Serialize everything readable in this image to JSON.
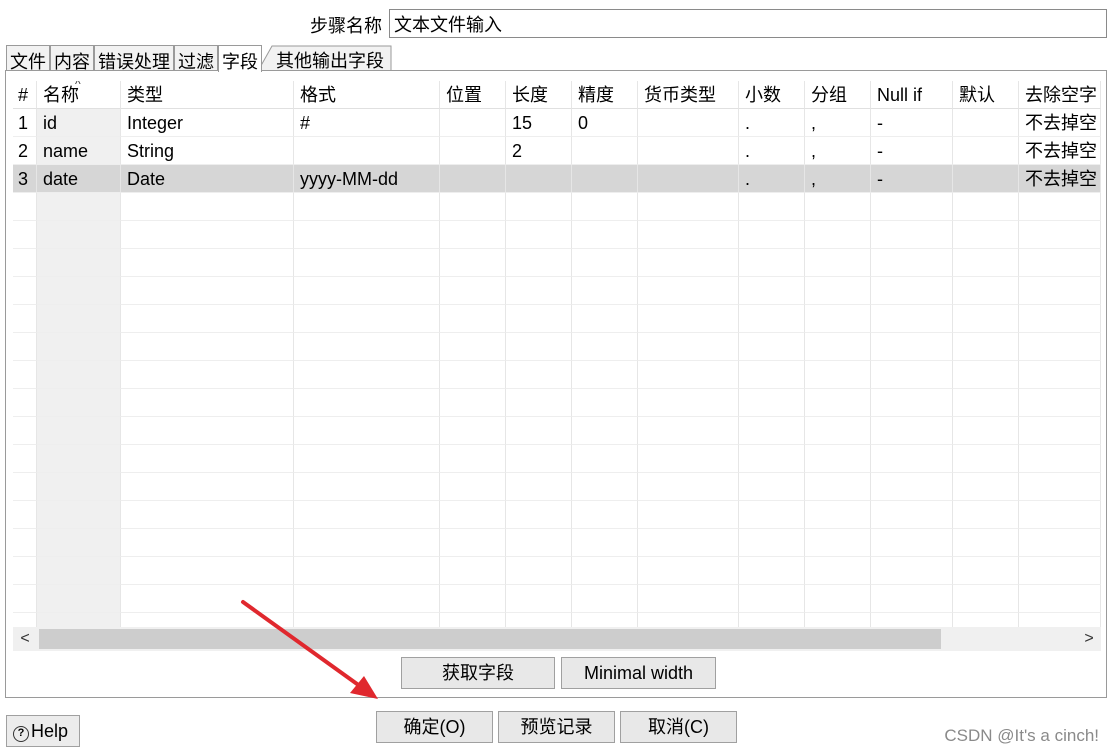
{
  "step": {
    "label": "步骤名称",
    "value": "文本文件输入"
  },
  "tabs": [
    {
      "label": "文件",
      "active": false
    },
    {
      "label": "内容",
      "active": false
    },
    {
      "label": "错误处理",
      "active": false
    },
    {
      "label": "过滤",
      "active": false
    },
    {
      "label": "字段",
      "active": true
    },
    {
      "label": "其他输出字段",
      "active": false
    }
  ],
  "table": {
    "columns": [
      "#",
      "名称",
      "类型",
      "格式",
      "位置",
      "长度",
      "精度",
      "货币类型",
      "小数",
      "分组",
      "Null if",
      "默认",
      "去除空字"
    ],
    "rows": [
      [
        "1",
        "id",
        "Integer",
        "#",
        "",
        "15",
        "0",
        "",
        ".",
        ",",
        "-",
        "",
        "不去掉空"
      ],
      [
        "2",
        "name",
        "String",
        "",
        "",
        "2",
        "",
        "",
        ".",
        ",",
        "-",
        "",
        "不去掉空"
      ],
      [
        "3",
        "date",
        "Date",
        "yyyy-MM-dd",
        "",
        "",
        "",
        "",
        ".",
        ",",
        "-",
        "",
        "不去掉空"
      ]
    ],
    "selected_row": 3
  },
  "scrollbar": {
    "left_icon": "chevron-left-icon",
    "right_icon": "chevron-right-icon"
  },
  "buttons": {
    "get_fields": "获取字段",
    "minimal_width": "Minimal width",
    "ok": "确定(O)",
    "preview": "预览记录",
    "cancel": "取消(C)",
    "help": "Help"
  },
  "watermark": "CSDN @It's a cinch!",
  "colors": {
    "annotation_arrow": "#e0282e",
    "selected_row": "#d6d6d6"
  }
}
